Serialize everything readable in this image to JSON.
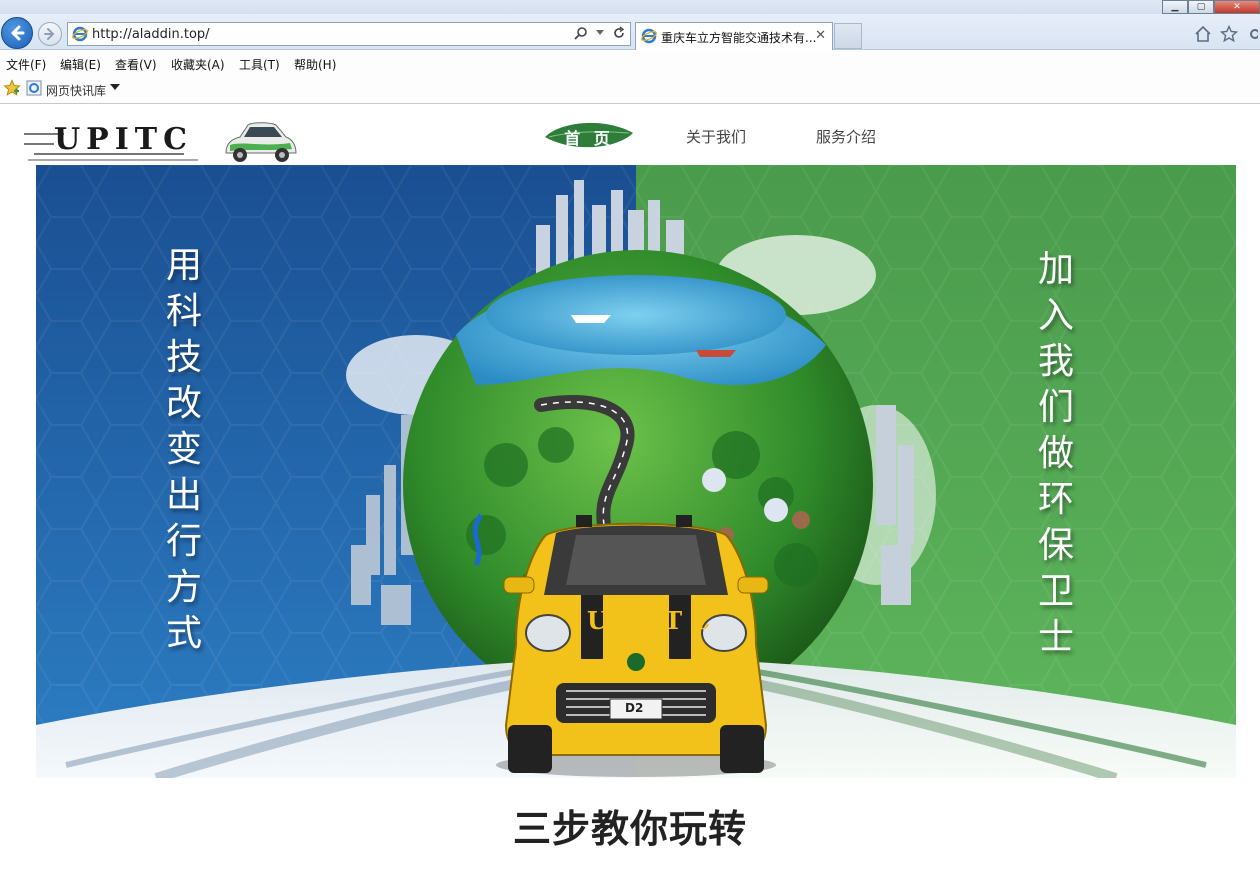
{
  "browser": {
    "url": "http://aladdin.top/",
    "tab_title": "重庆车立方智能交通技术有...",
    "tab_close": "✕",
    "menu": [
      "文件(F)",
      "编辑(E)",
      "查看(V)",
      "收藏夹(A)",
      "工具(T)",
      "帮助(H)"
    ],
    "favorites_item": "网页快讯库"
  },
  "site": {
    "logo_text": "UPITC",
    "nav": {
      "home": "首 页",
      "about": "关于我们",
      "services": "服务介绍"
    }
  },
  "banner": {
    "slogan_left": "用科技改变出行方式",
    "slogan_right": "加入我们做环保卫士",
    "car_brand": "UPITC",
    "car_plate": "D2"
  },
  "section": {
    "title": "三步教你玩转"
  },
  "colors": {
    "banner_blue": "#1d5fa8",
    "banner_green": "#3e9a4a",
    "nav_home_green": "#2f7d3a",
    "car_yellow": "#f2c21a"
  }
}
